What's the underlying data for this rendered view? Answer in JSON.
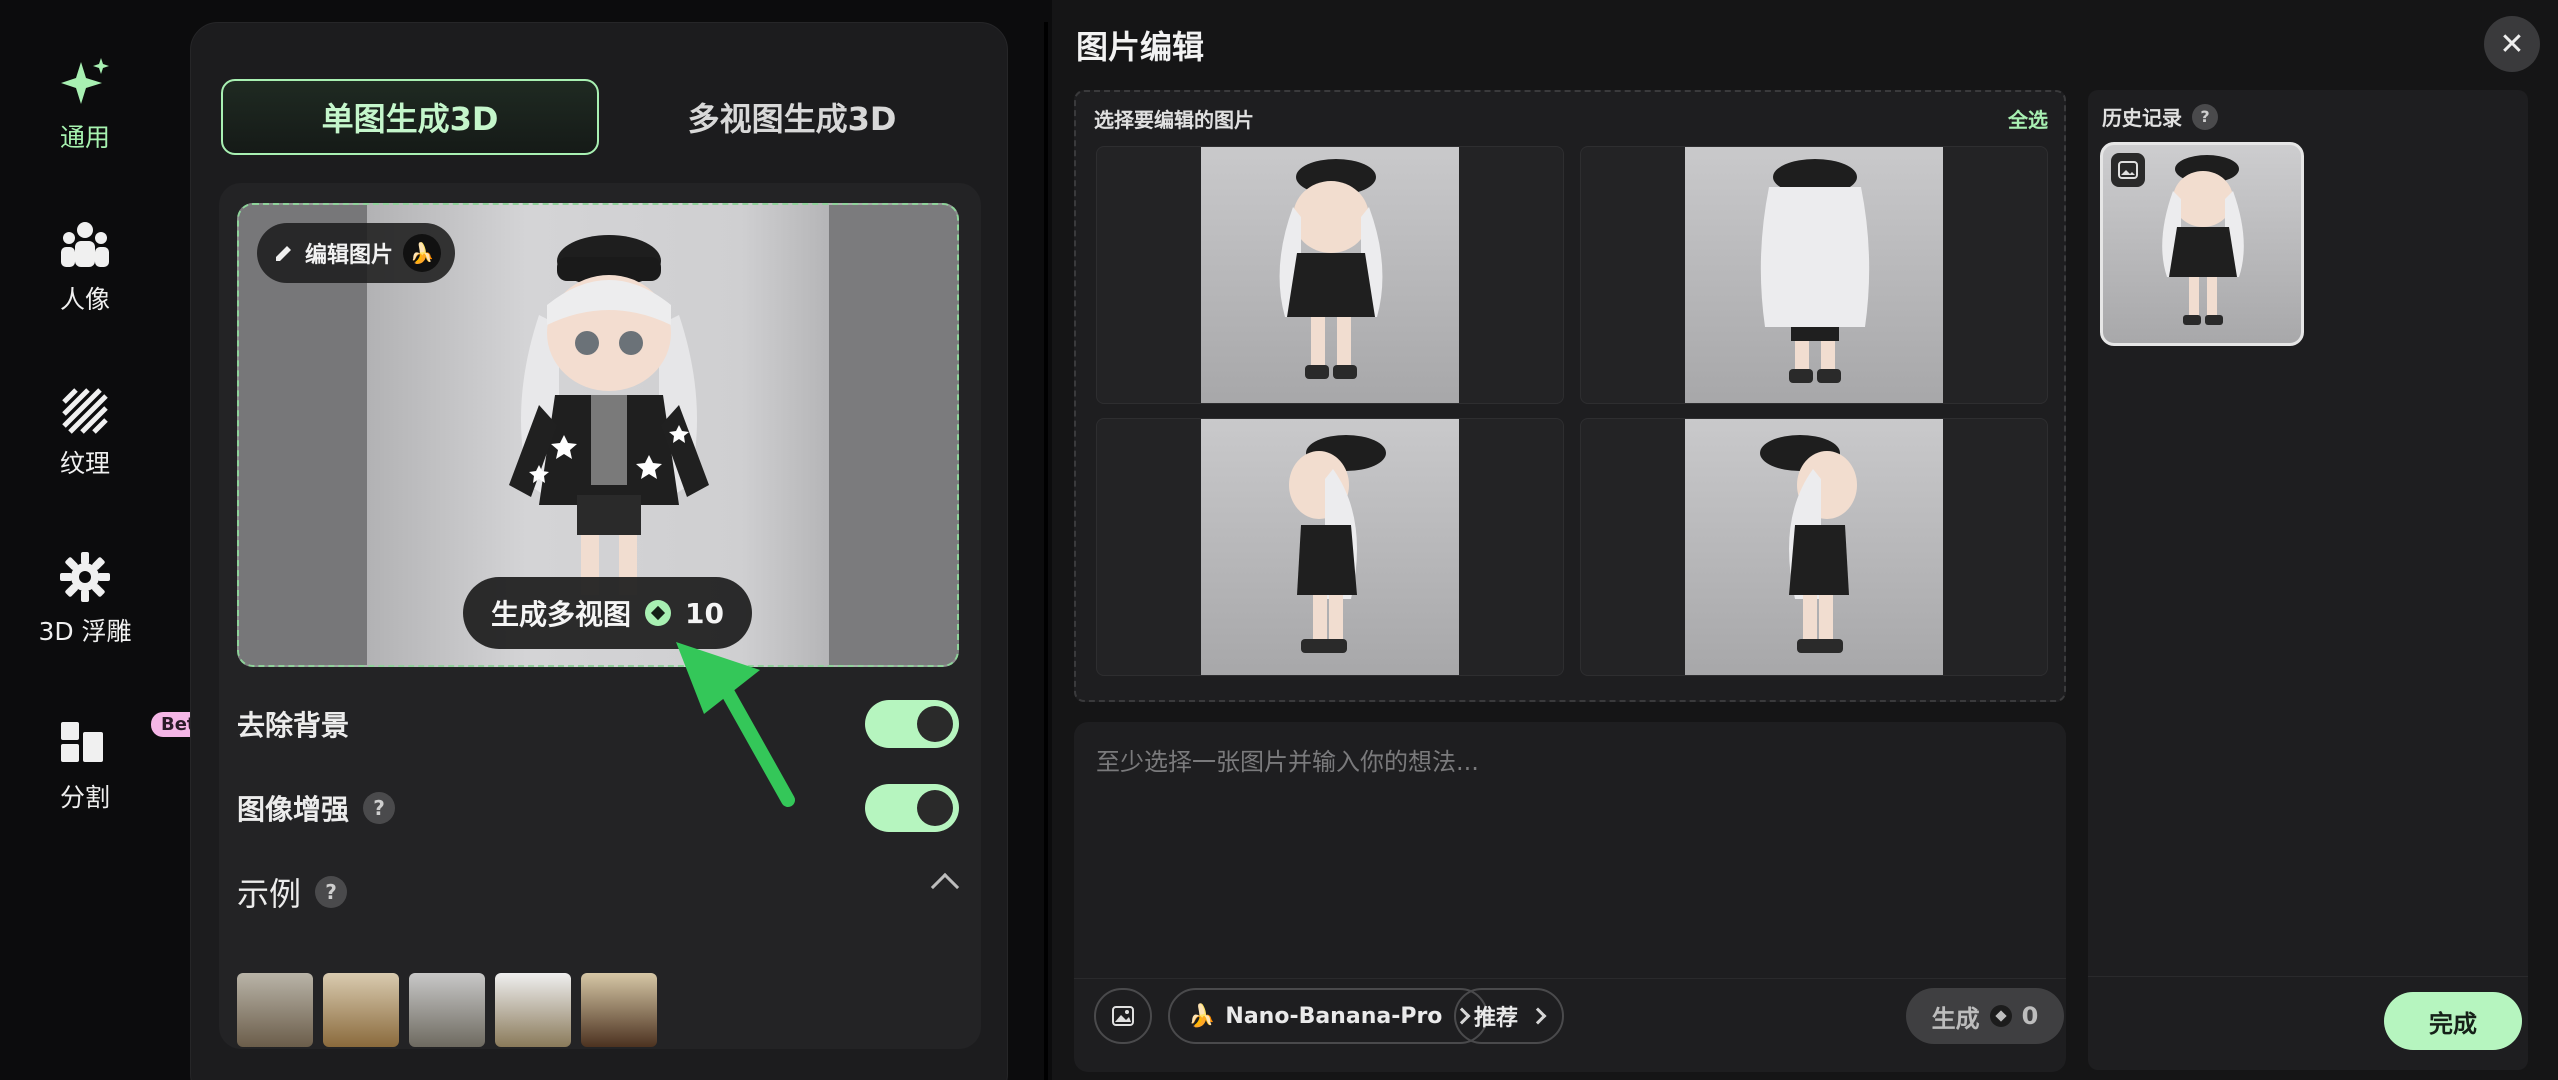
{
  "sidebar": {
    "items": [
      {
        "label": "通用",
        "icon": "sparkle-icon",
        "active": true
      },
      {
        "label": "人像",
        "icon": "people-icon"
      },
      {
        "label": "纹理",
        "icon": "texture-icon"
      },
      {
        "label": "3D 浮雕",
        "icon": "gear-icon"
      },
      {
        "label": "分割",
        "icon": "segment-icon",
        "badge": "Beta"
      }
    ]
  },
  "left_panel": {
    "tabs": [
      "单图生成3D",
      "多视图生成3D"
    ],
    "edit_image_label": "编辑图片",
    "generate_multiview_label": "生成多视图",
    "generate_multiview_cost": "10",
    "remove_bg_label": "去除背景",
    "enhance_label": "图像增强",
    "examples_label": "示例",
    "help_mark": "?"
  },
  "editor": {
    "title": "图片编辑",
    "select_header": "选择要编辑的图片",
    "select_all": "全选",
    "prompt_placeholder": "至少选择一张图片并输入你的想法...",
    "model_label": "Nano-Banana-Pro",
    "recommend_label": "推荐",
    "generate_label": "生成",
    "generate_cost": "0",
    "history_label": "历史记录",
    "done_label": "完成",
    "close_symbol": "✕"
  },
  "colors": {
    "accent": "#a8f0b2",
    "panel": "#1c1c1e",
    "background": "#0c0c0d"
  }
}
